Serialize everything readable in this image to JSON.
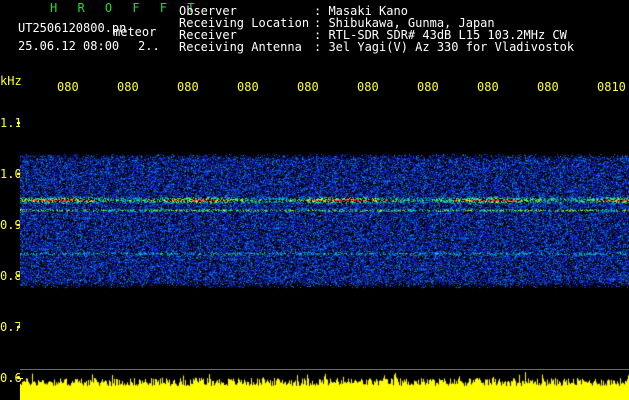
{
  "header": {
    "title": "H R O F F T",
    "filename": "UT2506120800.pn",
    "meteor_tag": "meteor",
    "datetime": "25.06.12 08:00",
    "counter": "2..",
    "observer_label": "Observer",
    "observer_value": ": Masaki Kano",
    "location_label": "Receiving Location",
    "location_value": ": Shibukawa, Gunma, Japan",
    "receiver_label": "Receiver",
    "receiver_value": ": RTL-SDR SDR# 43dB L15 103.2MHz CW",
    "antenna_label": "Receiving Antenna",
    "antenna_value": ": 3el Yagi(V) Az 330 for Vladivostok"
  },
  "axes": {
    "y_unit": "kHz",
    "x_ticks": [
      "080",
      "080",
      "080",
      "080",
      "080",
      "080",
      "080",
      "080",
      "080",
      "0810"
    ],
    "y_ticks": [
      "1.1",
      "1.0",
      "0.9",
      "0.8",
      "0.7",
      "0.6"
    ]
  },
  "chart_data": {
    "type": "heatmap",
    "ylabel": "kHz",
    "ylim": [
      0.6,
      1.15
    ],
    "x_tick_labels": [
      "080",
      "080",
      "080",
      "080",
      "080",
      "080",
      "080",
      "080",
      "080",
      "0810"
    ],
    "y_tick_values": [
      1.1,
      1.0,
      0.9,
      0.8,
      0.7,
      0.6
    ],
    "signal_band_khz": [
      0.79,
      1.03
    ],
    "strong_trace_khz": 0.95,
    "secondary_trace_khz": 0.93,
    "faint_trace_khz": 0.845,
    "colors": {
      "background": "#000000",
      "noise": "#1a3cff",
      "mid": "#00e0c0",
      "high": "#c8ff00",
      "peak": "#ff2a4a",
      "level": "#ffff00"
    }
  }
}
